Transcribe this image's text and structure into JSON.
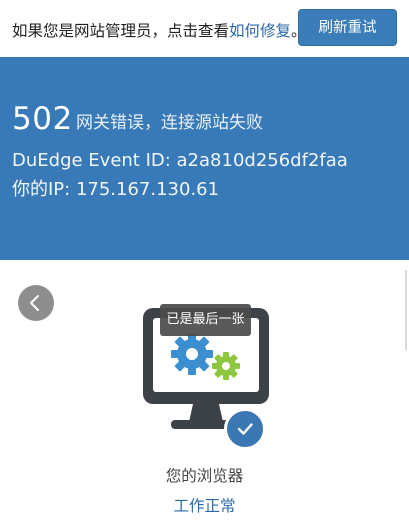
{
  "notice": {
    "prefix": "如果您是网站管理员，点击查看",
    "link_text": "如何修复",
    "suffix": "。"
  },
  "retry_button": {
    "label": "刷新重试"
  },
  "error": {
    "code": "502",
    "message": "网关错误，连接源站失败",
    "event_id_line": "DuEdge Event ID: a2a810d256df2faa",
    "ip_line": "你的IP: 175.167.130.61"
  },
  "status": {
    "toast": "已是最后一张",
    "browser_label": "您的浏览器",
    "browser_state": "工作正常"
  },
  "icons": {
    "back": "chevron-left-icon",
    "monitor": "monitor-gears-icon",
    "check": "check-icon"
  },
  "colors": {
    "panel_blue": "#377ab7",
    "link_blue": "#2c6aa8",
    "gear_blue": "#3b8fd0",
    "gear_green": "#8dc63f",
    "monitor_dark": "#3c4247"
  }
}
